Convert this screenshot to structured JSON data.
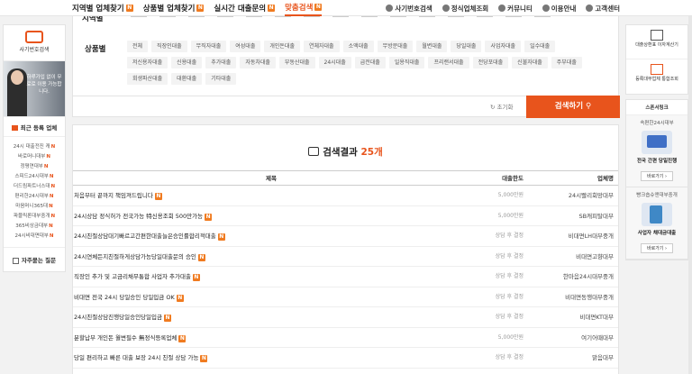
{
  "nav": {
    "items": [
      {
        "label": "지역별 업체찾기",
        "new": true,
        "active": false
      },
      {
        "label": "상품별 업체찾기",
        "new": true,
        "active": false
      },
      {
        "label": "실시간 대출문의",
        "new": true,
        "active": false
      },
      {
        "label": "맞춤검색",
        "new": true,
        "active": true
      }
    ],
    "right": [
      {
        "label": "사기번호검색",
        "icon": "search-icon"
      },
      {
        "label": "정식업체조회",
        "icon": "document-icon"
      },
      {
        "label": "커뮤니티",
        "icon": "chat-icon"
      },
      {
        "label": "이용안내",
        "icon": "check-icon"
      },
      {
        "label": "고객센터",
        "icon": "user-icon"
      }
    ]
  },
  "left_sidebar": {
    "search_number": "사기번호검색",
    "banner_text": "하루가입 없이 무료로 이용 가능합니다.",
    "recent_title": "최근 등록 업체",
    "recent_items": [
      "24시 대출전진 캐",
      "바로머니대부",
      "정평연대부",
      "스피드24시대부",
      "더드림파트너스대",
      "편리한24시대부",
      "마음머니365대",
      "파블릭론대부중개",
      "365비상금대부",
      "24시비대면대부"
    ],
    "faq": "자주묻는 질문"
  },
  "filter": {
    "category_label": "상품별",
    "chips": [
      "전체",
      "직장인대출",
      "무직자대출",
      "여성대출",
      "개인돈대출",
      "연체자대출",
      "소액대출",
      "무방문대출",
      "월변대출",
      "당일대출",
      "사업자대출",
      "일수대출",
      "저신용자대출",
      "신용대출",
      "추가대출",
      "자동차대출",
      "부동산대출",
      "24시대출",
      "급전대출",
      "일용직대출",
      "프리랜서대출",
      "전당포대출",
      "신불자대출",
      "주부대출",
      "회생파산대출",
      "대환대출",
      "기타대출"
    ],
    "reset_label": "초기화",
    "search_button": "검색하기"
  },
  "results": {
    "title_prefix": "검색결과",
    "count": "25개",
    "columns": [
      "제목",
      "대출한도",
      "업체명"
    ],
    "rows": [
      {
        "title": "처음부터 끝까지 책임져드립니다",
        "limit": "5,000만원",
        "company": "24시빨리회망대부"
      },
      {
        "title": "24시상담 정식허가 전국가능 特신용조회 500만가능",
        "limit": "5,000만원",
        "company": "SB캐피탈대부"
      },
      {
        "title": "24시친절상담대기빠르고간편한대출늘은승인률합리적대출",
        "limit": "상담 후 결정",
        "company": "비대면LH대부중개"
      },
      {
        "title": "24시연체든지친절하게상담가능당일대출문의 승인",
        "limit": "상담 후 결정",
        "company": "비대면고향대부"
      },
      {
        "title": "직장인 추가 및 고금리채무통합 사업자 추가대출",
        "limit": "상담 후 결정",
        "company": "한마음24시대부중개"
      },
      {
        "title": "비대면 전국 24시 당일승인 당일입금 OK",
        "limit": "상담 후 결정",
        "company": "비대면동행대부중개"
      },
      {
        "title": "24시친절상담진행당일승인당일입금",
        "limit": "상담 후 결정",
        "company": "비대면KT대부"
      },
      {
        "title": "분할납부 개인돈 월변필수 無정식등록업체",
        "limit": "5,000만원",
        "company": "여기어때대부"
      },
      {
        "title": "당일 편리하고 빠른 대출 보장 24시 친절 상담 가능",
        "limit": "상담 후 결정",
        "company": "맑음대부"
      }
    ]
  },
  "right_sidebar": {
    "items": [
      "대출상환표 이자계산기",
      "등록대부업체 통합조회"
    ],
    "sponsor_title": "스폰서링크",
    "ads": [
      {
        "top": "속편한24시대부",
        "body": "전국 간편 당일진행",
        "button": "바로가기"
      },
      {
        "top": "빵크숍슈앤대부중개",
        "body": "사업자 채대금대출",
        "button": "바로가기"
      }
    ]
  },
  "colors": {
    "accent": "#e8541c",
    "new_badge": "#f07b20"
  }
}
